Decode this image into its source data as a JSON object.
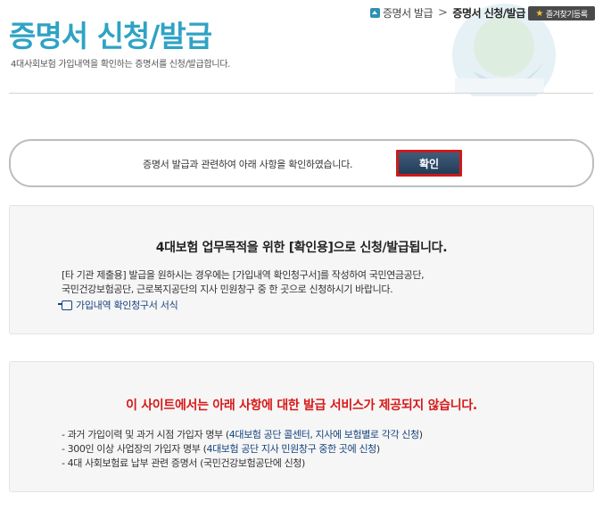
{
  "header": {
    "title": "증명서 신청/발급",
    "description": "4대사회보험 가입내역을 확인하는 증명서를 신청/발급합니다."
  },
  "breadcrumb": {
    "parent": "증명서 발급",
    "separator": ">",
    "current": "증명서 신청/발급"
  },
  "favorite_button": {
    "label": "즐겨찾기등록"
  },
  "confirm": {
    "text": "증명서 발급과 관련하여 아래 사항을 확인하였습니다.",
    "button_label": "확인"
  },
  "notice1": {
    "heading": "4대보험 업무목적을 위한 [확인용]으로 신청/발급됩니다.",
    "lines": [
      "[타 기관 제출용] 발급을 원하시는 경우에는 [가입내역 확인청구서]를 작성하여 국민연금공단,",
      "국민건강보험공단, 근로복지공단의 지사 민원창구 중 한 곳으로 신청하시기 바랍니다."
    ],
    "link_label": "가입내역 확인청구서 서식"
  },
  "notice2": {
    "heading": "이 사이트에서는 아래 사항에 대한 발급 서비스가 제공되지 않습니다.",
    "items": [
      {
        "prefix": "- 과거 가입이력 및 과거 시점 가입자 명부 (",
        "highlight": "4대보험 공단 콜센터, 지사에 보험별로 각각 신청",
        "suffix": ")"
      },
      {
        "prefix": "- 300인 이상 사업장의 가입자 명부 (",
        "highlight": "4대보험 공단 지사 민원창구 중한 곳에 신청",
        "suffix": ")"
      },
      {
        "prefix": "- 4대 사회보험료 납부 관련 증명서 (국민건강보험공단에 신청)",
        "highlight": "",
        "suffix": ""
      }
    ]
  },
  "colors": {
    "title": "#2fa3c4",
    "confirm_button": "#2c4764",
    "confirm_highlight": "#cc1a1a",
    "warning_heading": "#d81818",
    "link": "#15437c"
  }
}
